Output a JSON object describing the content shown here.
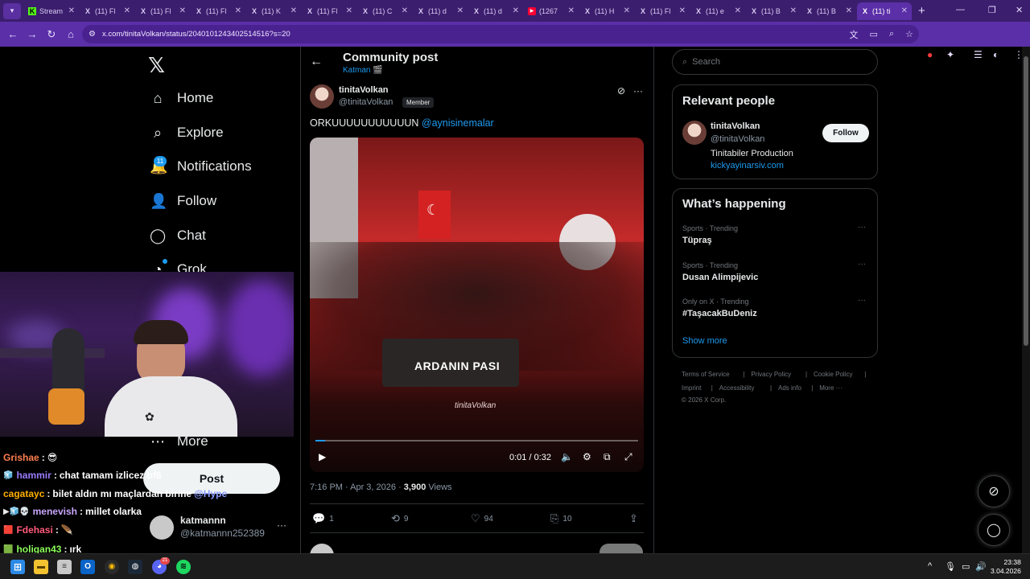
{
  "browser": {
    "tabs": [
      {
        "title": "Stream",
        "favicon": "K",
        "active": false
      },
      {
        "title": "(11) Fl",
        "favicon": "X",
        "active": false
      },
      {
        "title": "(11) Fl",
        "favicon": "X",
        "active": false
      },
      {
        "title": "(11) Fl",
        "favicon": "X",
        "active": false
      },
      {
        "title": "(11) K",
        "favicon": "X",
        "active": false
      },
      {
        "title": "(11) Fl",
        "favicon": "X",
        "active": false
      },
      {
        "title": "(11) C",
        "favicon": "X",
        "active": false
      },
      {
        "title": "(11) d",
        "favicon": "X",
        "active": false
      },
      {
        "title": "(11) d",
        "favicon": "X",
        "active": false
      },
      {
        "title": "(1267",
        "favicon": "▶",
        "active": false
      },
      {
        "title": "(11) H",
        "favicon": "X",
        "active": false
      },
      {
        "title": "(11) Fl",
        "favicon": "X",
        "active": false
      },
      {
        "title": "(11) e",
        "favicon": "X",
        "active": false
      },
      {
        "title": "(11) B",
        "favicon": "X",
        "active": false
      },
      {
        "title": "(11) B",
        "favicon": "X",
        "active": false
      },
      {
        "title": "(11) ti",
        "favicon": "X",
        "active": true
      }
    ],
    "url": "x.com/tinitaVolkan/status/2040101243402514516?s=20"
  },
  "nav": {
    "items": [
      {
        "label": "Home",
        "icon": "home-icon",
        "glyph": "⌂"
      },
      {
        "label": "Explore",
        "icon": "search-icon",
        "glyph": "⌕"
      },
      {
        "label": "Notifications",
        "icon": "bell-icon",
        "glyph": "🔔"
      },
      {
        "label": "Follow",
        "icon": "follow-icon",
        "glyph": "👤"
      },
      {
        "label": "Chat",
        "icon": "chat-icon",
        "glyph": "◯"
      },
      {
        "label": "Grok",
        "icon": "grok-icon",
        "glyph": "◔"
      },
      {
        "label": "More",
        "icon": "more-icon",
        "glyph": "⋯"
      }
    ],
    "notification_count": "11",
    "post_label": "Post",
    "account": {
      "name": "katmannn",
      "handle": "@katmannn252389"
    }
  },
  "stream_chat": [
    {
      "user": "Grishae",
      "color": "#ff7f50",
      "message": "",
      "emote": "😎",
      "badge": ""
    },
    {
      "user": "hammir",
      "color": "#9b7bff",
      "message": "chat tamam izlicez bf6",
      "badge": "🧊"
    },
    {
      "user": "cagatayc",
      "color": "#ffb000",
      "message": "bilet aldın mı maçlardan birine",
      "mention": "@Hype",
      "badge": ""
    },
    {
      "user": "menevish",
      "color": "#c9a6ff",
      "message": "millet olarka",
      "badge": "▶🧊💀"
    },
    {
      "user": "Fdehasi",
      "color": "#ff5a7a",
      "message": "",
      "emote": "🪶",
      "badge": "🟥"
    },
    {
      "user": "holigan43",
      "color": "#8cff5a",
      "message": "ırk",
      "badge": "🟩"
    }
  ],
  "post": {
    "header_title": "Community post",
    "header_sub": "Katman 🎬",
    "author_name": "tinitaVolkan",
    "author_handle": "@tinitaVolkan",
    "member_badge": "Member",
    "text": "ORKUUUUUUUUUUUN",
    "mention": "@aynisinemalar",
    "video": {
      "overlay_text": "ARDANIN PASI",
      "watermark": "tinitaVolkan",
      "time": "0:01 / 0:32",
      "progress": 0.03
    },
    "time": "7:16 PM · Apr 3, 2026 · ",
    "views_count": "3,900",
    "views_label": " Views",
    "stats": {
      "replies": "1",
      "reposts": "9",
      "likes": "94",
      "bookmarks": "10"
    }
  },
  "sidebar": {
    "search_placeholder": "Search",
    "relevant": {
      "title": "Relevant people",
      "name": "tinitaVolkan",
      "handle": "@tinitaVolkan",
      "bio": "Tinitabiler Production",
      "link": "kickyayinarsiv.com",
      "follow_label": "Follow"
    },
    "happening": {
      "title": "What’s happening",
      "trends": [
        {
          "context": "Sports · Trending",
          "name": "Tüpraş"
        },
        {
          "context": "Sports · Trending",
          "name": "Dusan Alimpijevic"
        },
        {
          "context": "Only on X · Trending",
          "name": "#TaşacakBuDeniz"
        }
      ],
      "show_more": "Show more"
    },
    "footer": {
      "row1": [
        "Terms of Service",
        "|",
        "Privacy Policy",
        "|",
        "Cookie Policy",
        "|"
      ],
      "row2": [
        "Imprint",
        "|",
        "Accessibility",
        "|",
        "Ads info",
        "|",
        "More ···"
      ],
      "copyright": "© 2026 X Corp."
    }
  },
  "taskbar": {
    "time": "23:38",
    "date": "3.04.2026",
    "discord_badge": "21"
  },
  "colors": {
    "accent": "#1d9bf0",
    "browser_frame": "#5b2fa8",
    "background": "#000000"
  }
}
